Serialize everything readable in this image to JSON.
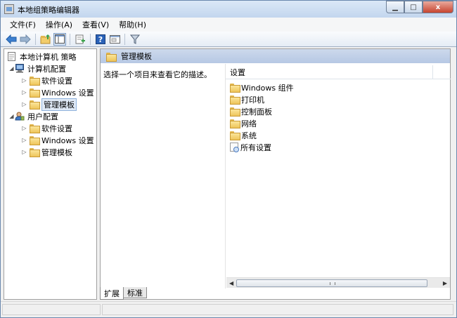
{
  "window": {
    "title": "本地组策略编辑器",
    "buttons": {
      "minimize": "▁",
      "maximize": "□",
      "close": "x"
    }
  },
  "menubar": {
    "items": [
      "文件(F)",
      "操作(A)",
      "查看(V)",
      "帮助(H)"
    ]
  },
  "toolbar": {
    "icons": [
      "back-arrow-icon",
      "forward-arrow-icon",
      "up-folder-icon",
      "show-hide-tree-icon",
      "export-list-icon",
      "help-icon",
      "properties-icon",
      "filter-icon"
    ]
  },
  "tree": {
    "root": "本地计算机 策略",
    "computer_config": {
      "label": "计算机配置",
      "children": [
        "软件设置",
        "Windows 设置",
        "管理模板"
      ]
    },
    "user_config": {
      "label": "用户配置",
      "children": [
        "软件设置",
        "Windows 设置",
        "管理模板"
      ]
    }
  },
  "details": {
    "header": "管理模板",
    "description": "选择一个项目来查看它的描述。",
    "column_header": "设置",
    "items": [
      "Windows 组件",
      "打印机",
      "控制面板",
      "网络",
      "系统",
      "所有设置"
    ]
  },
  "tabs": [
    "扩展",
    "标准"
  ],
  "colors": {
    "header_blue": "#b6c8e4",
    "folder_yellow": "#eec55a",
    "close_red": "#c7442f",
    "selection": "#dfe9f6"
  }
}
